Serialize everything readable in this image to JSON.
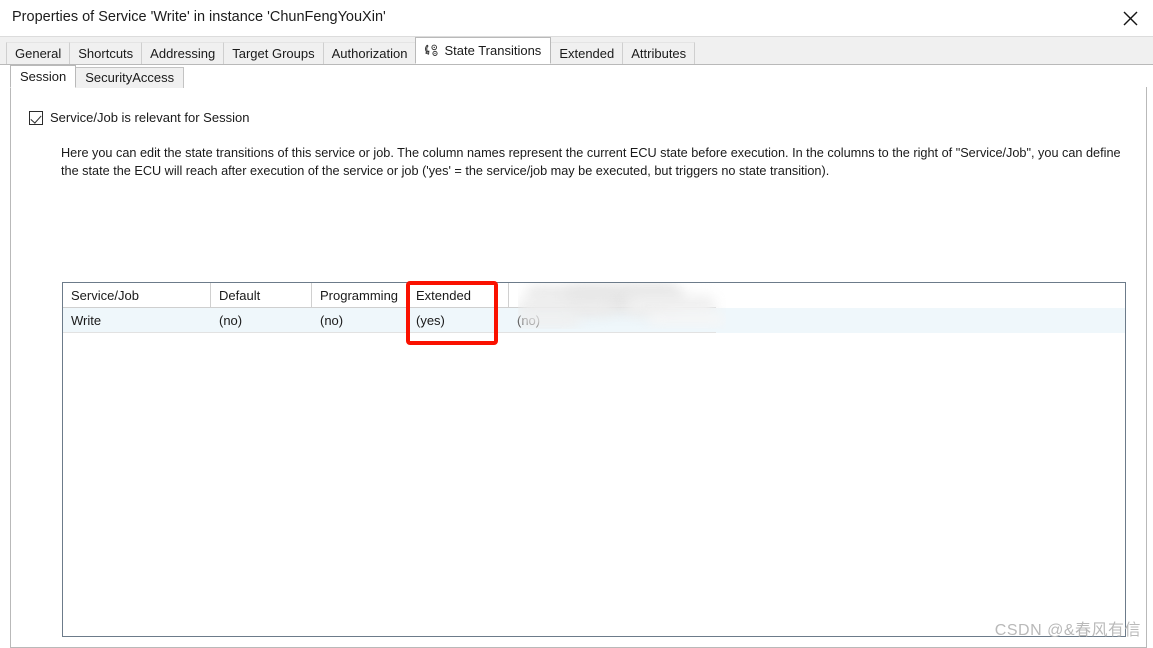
{
  "window": {
    "title": "Properties of Service 'Write' in instance 'ChunFengYouXin'",
    "close_label": "×"
  },
  "tabs": [
    {
      "label": "General",
      "active": false
    },
    {
      "label": "Shortcuts",
      "active": false
    },
    {
      "label": "Addressing",
      "active": false
    },
    {
      "label": "Target Groups",
      "active": false
    },
    {
      "label": "Authorization",
      "active": false
    },
    {
      "label": "State Transitions",
      "active": true,
      "icon": "state-transitions-icon"
    },
    {
      "label": "Extended",
      "active": false
    },
    {
      "label": "Attributes",
      "active": false
    }
  ],
  "subtabs": [
    {
      "label": "Session",
      "active": true
    },
    {
      "label": "SecurityAccess",
      "active": false
    }
  ],
  "content": {
    "checkbox_label": "Service/Job is relevant for Session",
    "checkbox_checked": true,
    "description": "Here you can edit the state transitions of this service or job. The column names represent the current ECU state before execution. In the columns to the right of \"Service/Job\", you can define the state the ECU will reach after execution of the service or job ('yes' = the service/job may be executed, but triggers no state transition)."
  },
  "table": {
    "columns": [
      "Service/Job",
      "Default",
      "Programming",
      "Extended",
      ""
    ],
    "rows": [
      {
        "cells": [
          "Write",
          "(no)",
          "(no)",
          "(yes)",
          "(no)"
        ]
      }
    ]
  },
  "annotation": {
    "highlight_color": "#fa1100",
    "highlight_target": "Extended"
  },
  "watermark": {
    "text": "CSDN @&春风有信"
  }
}
